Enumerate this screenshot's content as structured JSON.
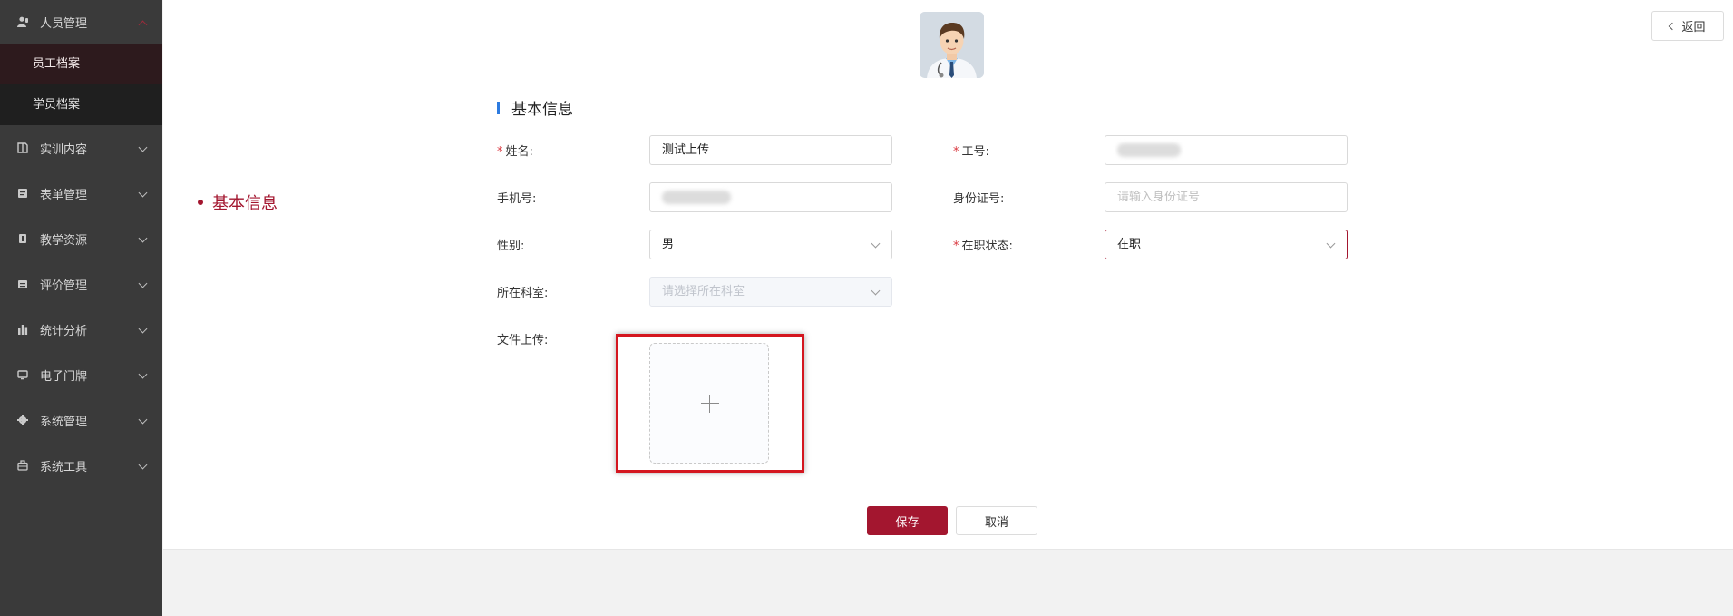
{
  "sidebar": {
    "groups": [
      {
        "label": "人员管理",
        "icon": "user-icon",
        "expanded": true,
        "items": [
          {
            "label": "员工档案",
            "active": true
          },
          {
            "label": "学员档案",
            "active": false
          }
        ]
      },
      {
        "label": "实训内容",
        "icon": "book-icon"
      },
      {
        "label": "表单管理",
        "icon": "form-icon"
      },
      {
        "label": "教学资源",
        "icon": "resource-icon"
      },
      {
        "label": "评价管理",
        "icon": "evaluation-icon"
      },
      {
        "label": "统计分析",
        "icon": "bar-chart-icon"
      },
      {
        "label": "电子门牌",
        "icon": "monitor-icon"
      },
      {
        "label": "系统管理",
        "icon": "gear-icon"
      },
      {
        "label": "系统工具",
        "icon": "toolbox-icon"
      }
    ]
  },
  "header": {
    "back_label": "返回"
  },
  "anchor_nav": {
    "active_label": "基本信息"
  },
  "section": {
    "title": "基本信息"
  },
  "form": {
    "name": {
      "label": "姓名:",
      "required": true,
      "value": "测试上传"
    },
    "employee_no": {
      "label": "工号:",
      "required": true,
      "value": ""
    },
    "phone": {
      "label": "手机号:",
      "required": false,
      "value": ""
    },
    "id_card": {
      "label": "身份证号:",
      "required": false,
      "placeholder": "请输入身份证号"
    },
    "gender": {
      "label": "性别:",
      "value": "男"
    },
    "employment_status": {
      "label": "在职状态:",
      "required": true,
      "value": "在职"
    },
    "department": {
      "label": "所在科室:",
      "placeholder": "请选择所在科室",
      "disabled": true
    },
    "file_upload": {
      "label": "文件上传:"
    }
  },
  "actions": {
    "save_label": "保存",
    "cancel_label": "取消"
  },
  "colors": {
    "accent": "#a3162f",
    "sidebar_bg": "#3a3a3a",
    "section_bar": "#2d7be0",
    "highlight": "#d4161f"
  }
}
